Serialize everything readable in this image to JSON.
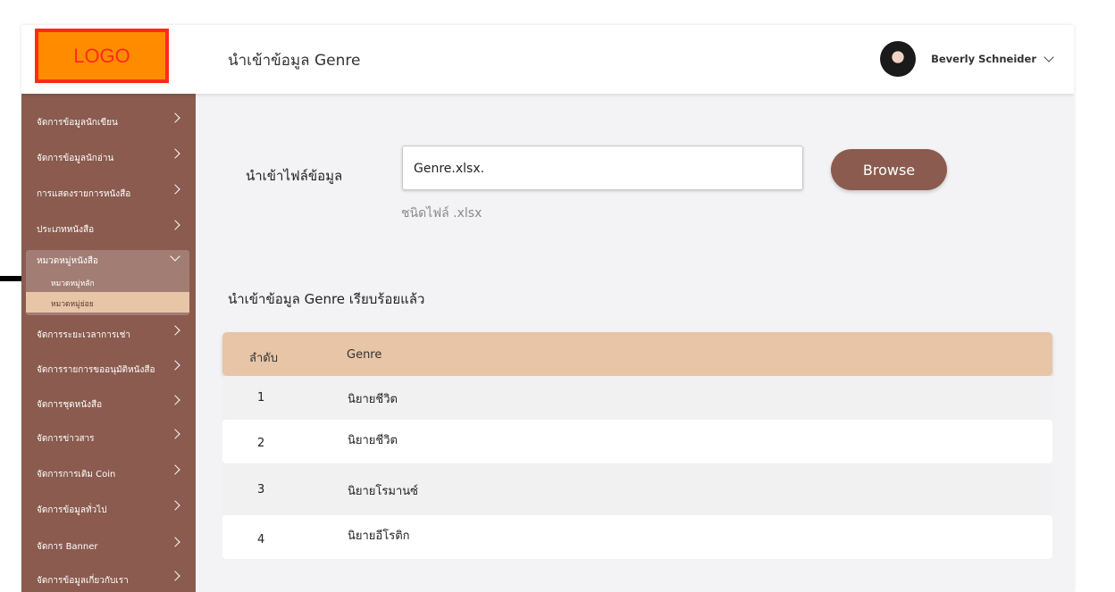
{
  "header": {
    "logo": "LOGO",
    "title": "นำเข้าข้อมูล Genre",
    "user_name": "Beverly Schneider",
    "icons": [
      "avatar",
      "chevron-down-icon"
    ]
  },
  "sidebar": {
    "items": [
      {
        "label": "จัดการข้อมูลนักเขียน"
      },
      {
        "label": "จัดการข้อมูลนักอ่าน"
      },
      {
        "label": "การแสดงรายการหนังสือ"
      },
      {
        "label": "ประเภทหนังสือ"
      }
    ],
    "active_group": {
      "label": "หมวดหมู่หนังสือ",
      "subitems": [
        {
          "label": "หมวดหมู่หลัก"
        },
        {
          "label": "หมวดหมู่ย่อย"
        }
      ]
    },
    "items_after": [
      {
        "label": "จัดการระยะเวลาการเช่า"
      },
      {
        "label": "จัดการรายการขออนุมัติหนังสือ"
      },
      {
        "label": "จัดการชุดหนังสือ"
      },
      {
        "label": "จัดการข่าวสาร"
      },
      {
        "label": "จัดการการเติม Coin"
      },
      {
        "label": "จัดการข้อมูลทั่วไป"
      },
      {
        "label": "จัดการ Banner"
      },
      {
        "label": "จัดการข้อมูลเกี่ยวกับเรา"
      }
    ],
    "colors": {
      "background": "#8a5b4e",
      "group": "#a27d74",
      "active_sub": "#e7c5a6"
    }
  },
  "import": {
    "label": "นำเข้าไฟล์ข้อมูล",
    "file_value": "Genre.xlsx.",
    "browse_label": "Browse",
    "hint": "ชนิดไฟล์ .xlsx"
  },
  "result": {
    "title": "นำเข้าข้อมูล Genre เรียบร้อยแล้ว",
    "columns": [
      "ลำดับ",
      "Genre"
    ],
    "rows": [
      {
        "no": "1",
        "genre": "นิยายชีวิต"
      },
      {
        "no": "2",
        "genre": "นิยายชีวิต"
      },
      {
        "no": "3",
        "genre": "นิยายโรมานซ์"
      },
      {
        "no": "4",
        "genre": "นิยายอีโรติก"
      }
    ]
  },
  "colors": {
    "accent": "#8a5b4e",
    "table_header": "#e7c5a6",
    "logo_fill": "#ff8c00",
    "logo_border": "#ff2a1a"
  }
}
